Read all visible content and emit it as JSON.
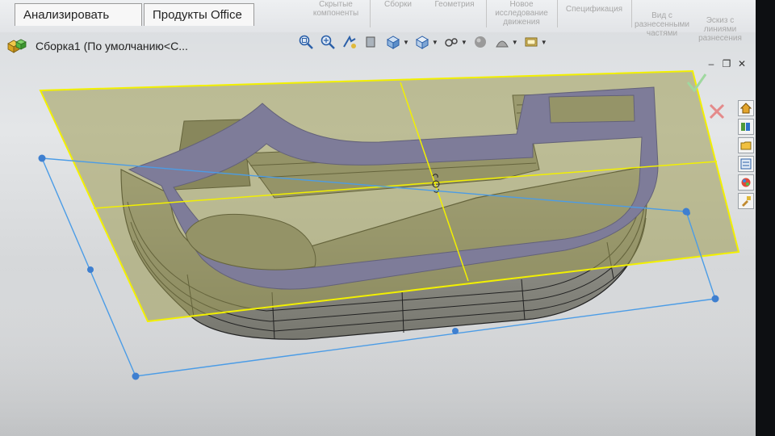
{
  "ribbon": {
    "tabs": [
      {
        "label": "Анализировать"
      },
      {
        "label": "Продукты Office"
      }
    ],
    "buttons": [
      {
        "line1": "Скрытые",
        "line2": "компоненты"
      },
      {
        "line1": "Сборки",
        "line2": ""
      },
      {
        "line1": "Геометрия",
        "line2": ""
      },
      {
        "line1": "Новое",
        "line2": "исследование",
        "line3": "движения"
      },
      {
        "line1": "Спецификация",
        "line2": ""
      },
      {
        "line1": "Вид с",
        "line2": "разнесенными",
        "line3": "частями"
      },
      {
        "line1": "Эскиз с",
        "line2": "линиями",
        "line3": "разнесения"
      }
    ]
  },
  "document": {
    "title": "Сборка1  (По умолчанию<С..."
  },
  "heads_up_toolbar": {
    "icons": [
      "zoom-to-fit-icon",
      "zoom-to-area-icon",
      "previous-view-icon",
      "section-view-icon",
      "view-orientation-icon",
      "display-style-icon",
      "hide-show-items-icon",
      "edit-appearance-icon",
      "apply-scene-icon",
      "view-settings-icon"
    ]
  },
  "colors": {
    "plane_fill": "#9c9a52",
    "plane_edge": "#f2f000",
    "cut_face": "#5a57f0",
    "selection_box": "#4b9ce6",
    "part_body": "#8f8f87"
  }
}
